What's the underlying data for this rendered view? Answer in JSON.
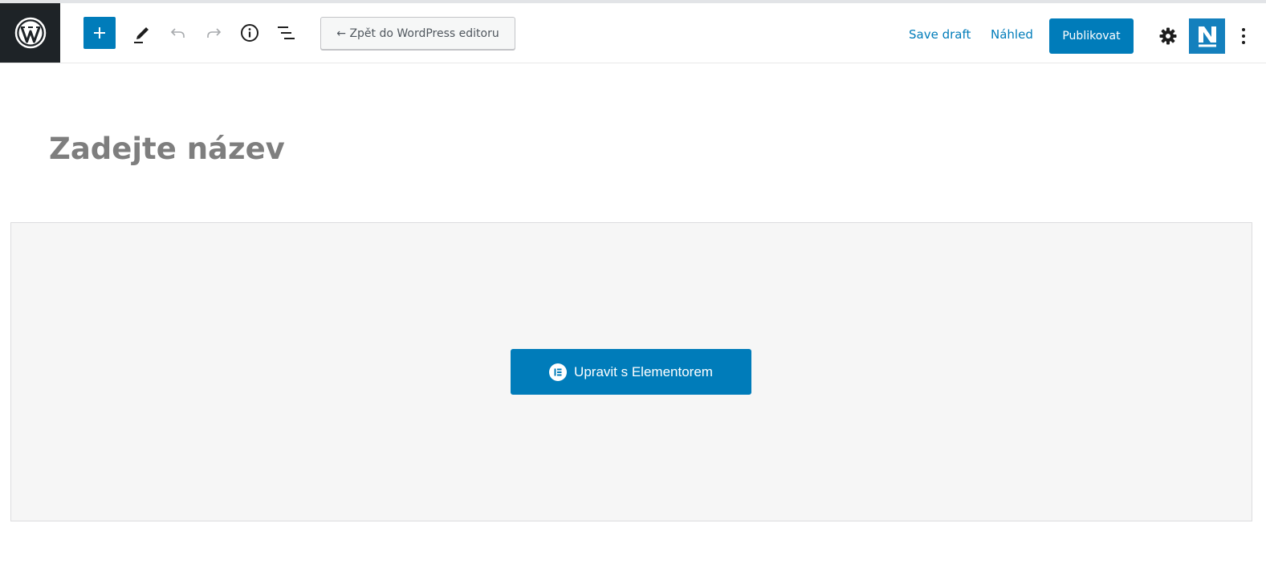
{
  "toolbar": {
    "back_label": "← Zpět do WordPress editoru",
    "save_draft_label": "Save draft",
    "preview_label": "Náhled",
    "publish_label": "Publikovat",
    "icons": [
      "wordpress-logo-icon",
      "plus-icon",
      "pencil-icon",
      "undo-icon",
      "redo-icon",
      "info-icon",
      "list-view-icon",
      "gear-icon",
      "n-logo-icon",
      "more-vertical-icon"
    ]
  },
  "editor": {
    "title_placeholder": "Zadejte název",
    "elementor_button_label": "Upravit s Elementorem"
  },
  "colors": {
    "accent": "#007cba",
    "dark_logo_bg": "#1e2327",
    "title_placeholder": "#7e7e7e",
    "panel_bg": "#f6f6f6"
  }
}
